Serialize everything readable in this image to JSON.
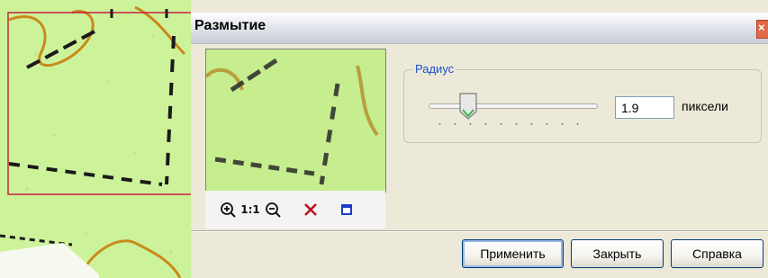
{
  "dialog": {
    "title": "Размытие",
    "close_label": "×"
  },
  "radius_group": {
    "label": "Радиус",
    "slider_value": 1.9,
    "value": "1.9",
    "units": "пиксели"
  },
  "preview_toolbar": {
    "zoom_in_icon": "zoom-in-icon",
    "actual_size_label": "1:1",
    "zoom_out_icon": "zoom-out-icon",
    "clear_icon": "x-icon",
    "frame_icon": "square-icon"
  },
  "buttons": {
    "apply": "Применить",
    "close": "Закрыть",
    "help": "Справка"
  },
  "colors": {
    "map_background": "#cdf39a",
    "contour_line": "#c98a1b",
    "selection_frame": "#c8213e",
    "label_accent": "#1a50c8",
    "clear_icon": "#c0101a",
    "frame_icon": "#1a3cc8"
  }
}
